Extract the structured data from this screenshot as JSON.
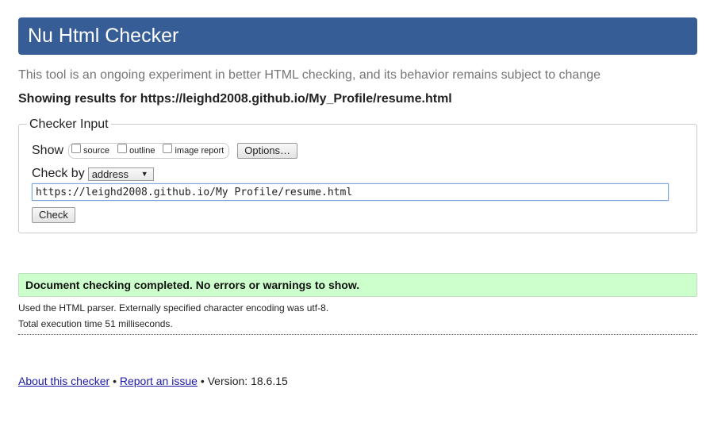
{
  "header": {
    "title": "Nu Html Checker"
  },
  "tagline": "This tool is an ongoing experiment in better HTML checking, and its behavior remains subject to change",
  "results": {
    "heading": "Showing results for https://leighd2008.github.io/My_Profile/resume.html"
  },
  "checker_input": {
    "legend": "Checker Input",
    "show_label": "Show",
    "show_options": [
      {
        "label": "source",
        "checked": false
      },
      {
        "label": "outline",
        "checked": false
      },
      {
        "label": "image report",
        "checked": false
      }
    ],
    "options_button": "Options…",
    "check_by_label": "Check by",
    "check_by_value": "address",
    "url_value": "https://leighd2008.github.io/My Profile/resume.html",
    "check_button": "Check"
  },
  "status": {
    "message": "Document checking completed. No errors or warnings to show.",
    "color": "#ccffcc"
  },
  "info": {
    "parser": "Used the HTML parser. Externally specified character encoding was utf-8.",
    "execution_time": "Total execution time 51 milliseconds."
  },
  "footer": {
    "about_link": "About this checker",
    "separator": "•",
    "report_link": "Report an issue",
    "version": "Version: 18.6.15"
  },
  "colors": {
    "header_bg": "#365d95",
    "link": "#1a1aa6"
  }
}
